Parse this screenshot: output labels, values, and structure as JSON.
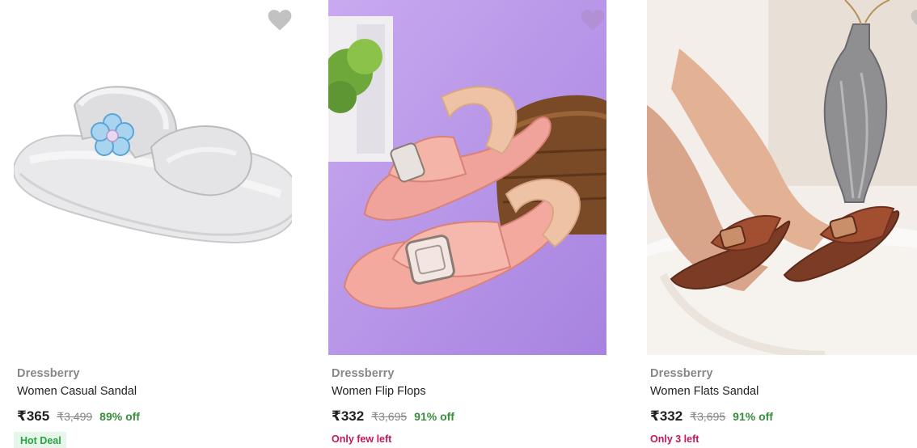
{
  "products": [
    {
      "brand": "Dressberry",
      "name": "Women Casual Sandal",
      "price": "₹365",
      "mrp": "₹3,499",
      "discount": "89% off",
      "tag": "Hot Deal",
      "image": "white-slide-sandal-with-blue-flower",
      "wishlist_icon": "heart-icon"
    },
    {
      "brand": "Dressberry",
      "name": "Women Flip Flops",
      "price": "₹332",
      "mrp": "₹3,695",
      "discount": "91% off",
      "tag": "Only few left",
      "image": "pink-buckle-strap-sandals-on-lilac-background",
      "wishlist_icon": "heart-icon"
    },
    {
      "brand": "Dressberry",
      "name": "Women Flats Sandal",
      "price": "₹332",
      "mrp": "₹3,695",
      "discount": "91% off",
      "tag": "Only 3 left",
      "image": "brown-flat-sandals-worn-on-feet",
      "wishlist_icon": "heart-icon"
    }
  ],
  "colors": {
    "discount": "#388e3c",
    "hot_deal_text": "#26a541",
    "hot_deal_bg": "#e7f6ea",
    "stock_warning": "#c2185b",
    "brand": "#878787",
    "wishlist": "#c2c2c2"
  }
}
